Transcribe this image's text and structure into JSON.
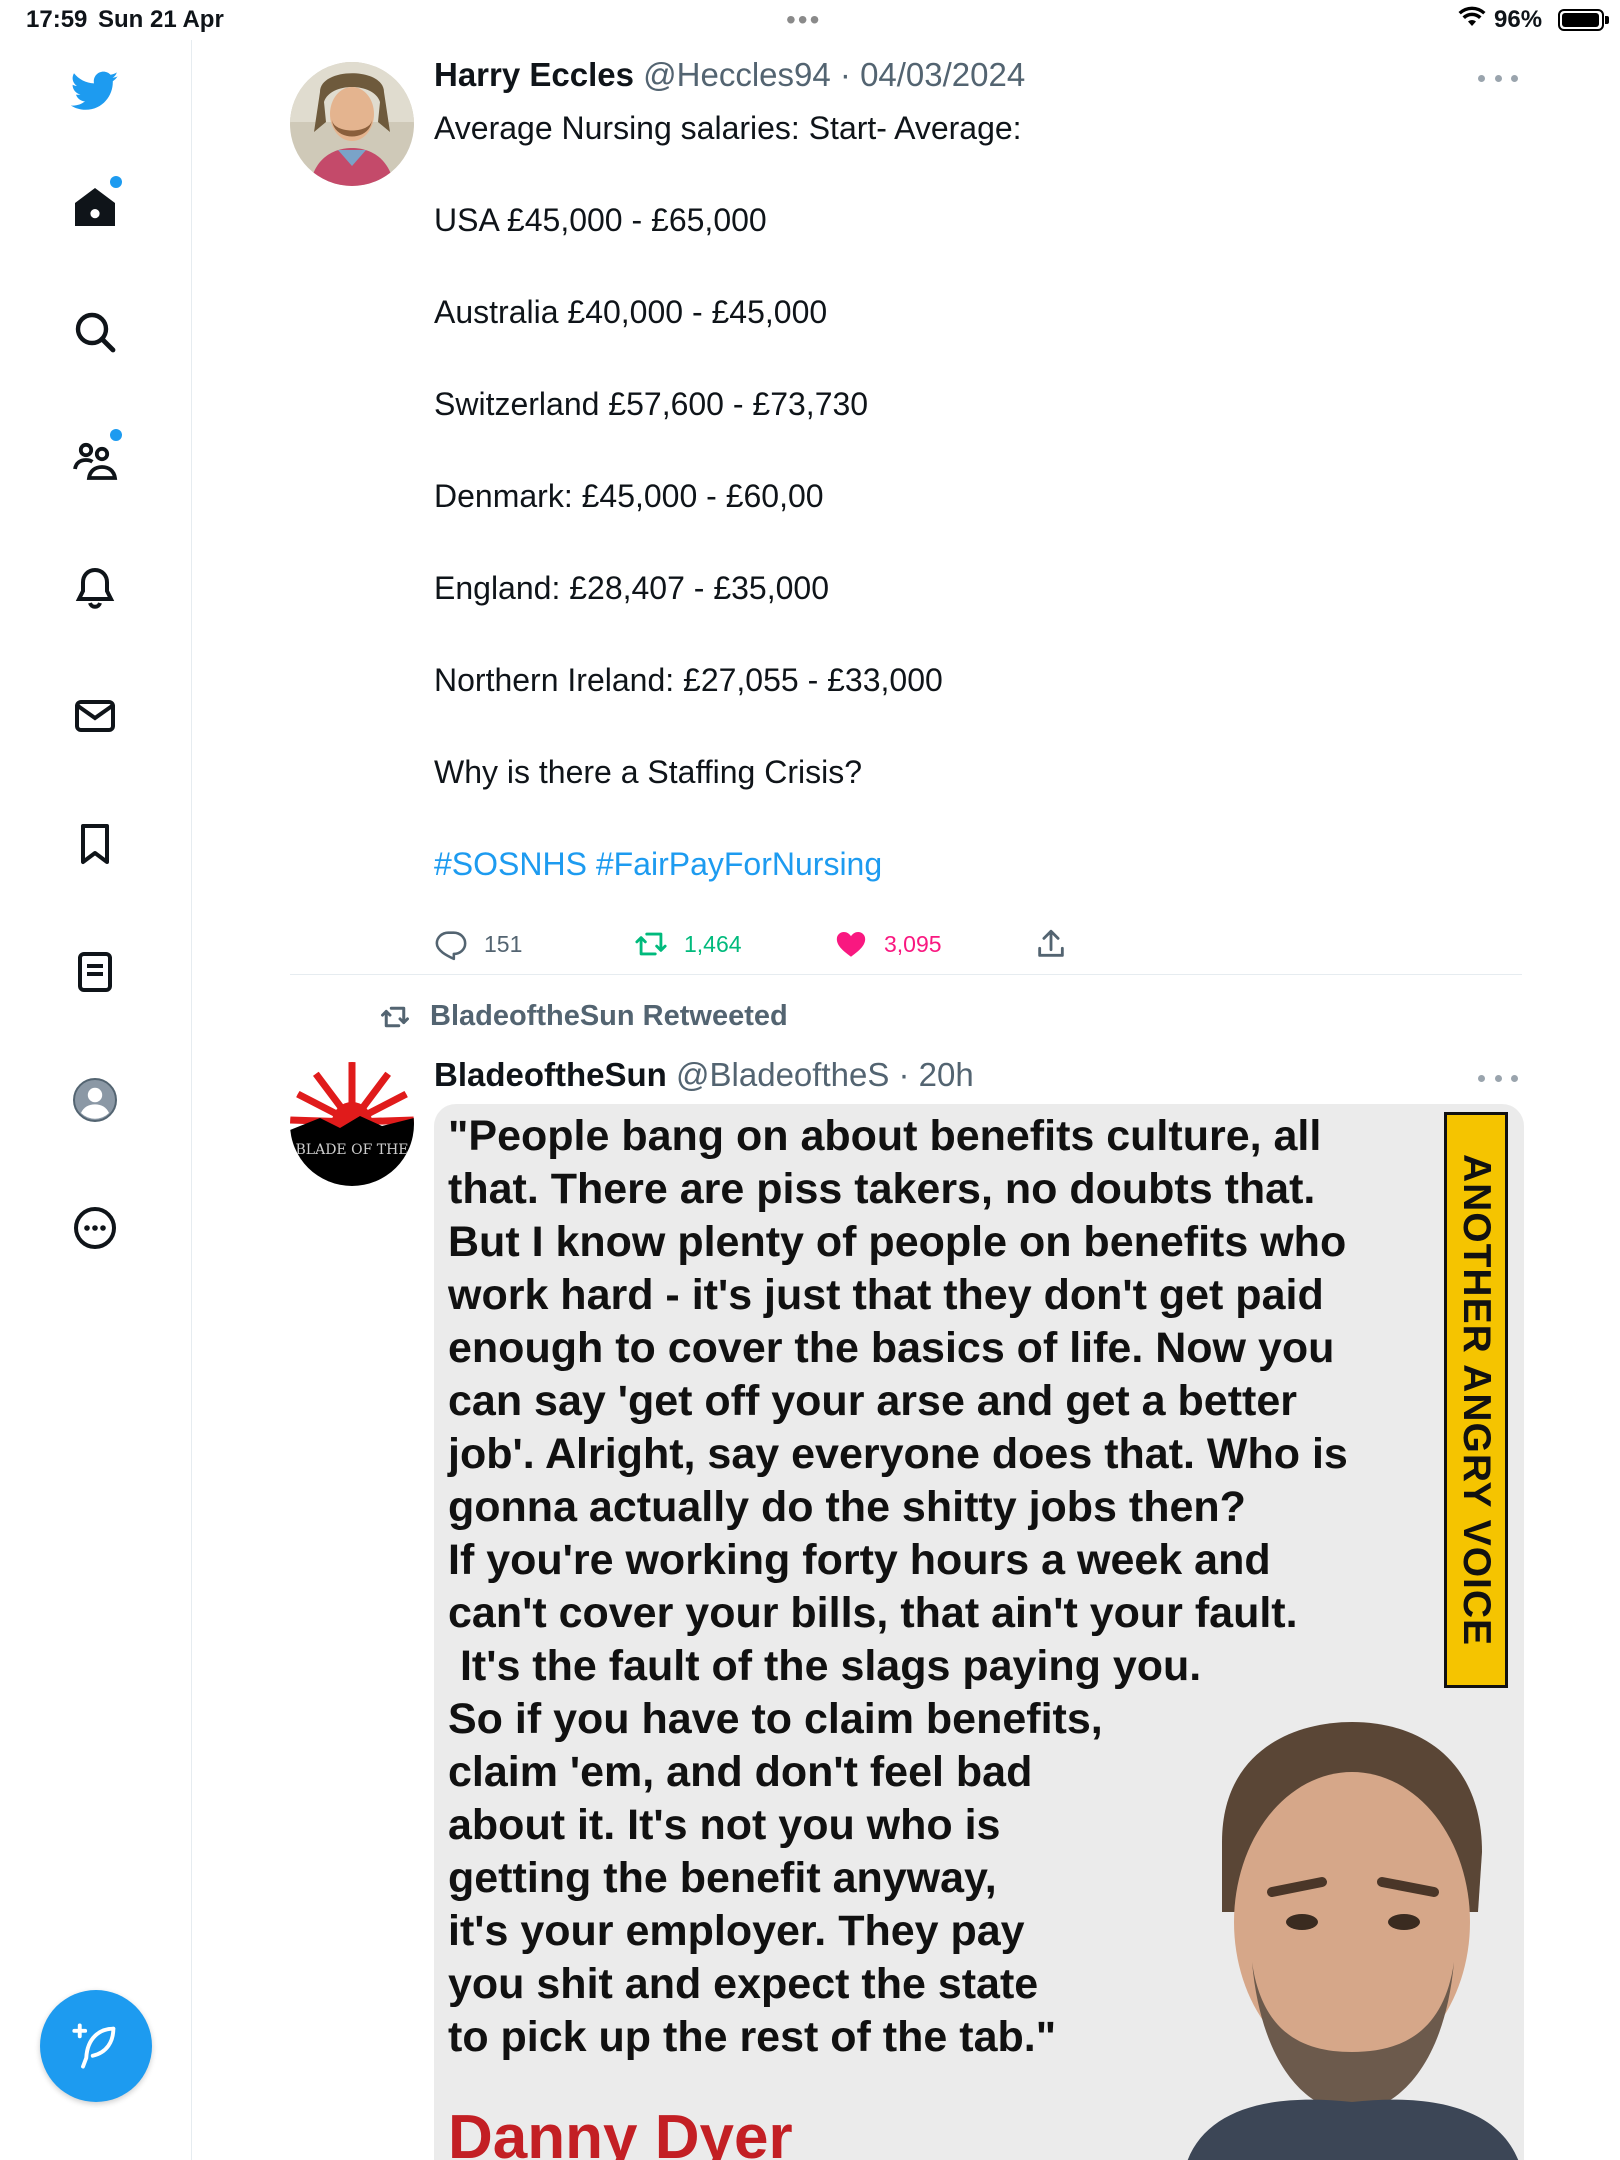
{
  "status_bar": {
    "time": "17:59",
    "date": "Sun 21 Apr",
    "battery": "96%"
  },
  "sidebar": {
    "items": [
      {
        "name": "twitter-logo-icon"
      },
      {
        "name": "home-icon"
      },
      {
        "name": "search-icon"
      },
      {
        "name": "communities-icon"
      },
      {
        "name": "notifications-icon"
      },
      {
        "name": "messages-icon"
      },
      {
        "name": "bookmarks-icon"
      },
      {
        "name": "lists-icon"
      },
      {
        "name": "profile-icon"
      },
      {
        "name": "more-icon"
      }
    ],
    "compose_icon": "compose-icon"
  },
  "tweet1": {
    "name": "Harry Eccles",
    "handle": "@Heccles94",
    "date": "04/03/2024",
    "lines": [
      "Average Nursing salaries: Start- Average:",
      "USA £45,000 - £65,000",
      "Australia £40,000 -  £45,000",
      "Switzerland £57,600 -  £73,730",
      "Denmark: £45,000 - £60,00",
      "England: £28,407 - £35,000",
      "Northern Ireland: £27,055 - £33,000",
      "Why is there a Staffing Crisis?"
    ],
    "hashtags": "#SOSNHS #FairPayForNursing",
    "replies": "151",
    "retweets": "1,464",
    "likes": "3,095",
    "colors": {
      "retweet": "#00ba7c",
      "like": "#f91880",
      "link": "#1d9bf0"
    }
  },
  "tweet2": {
    "retweeted_by": "BladeoftheSun Retweeted",
    "name": "BladeoftheSun",
    "handle": "@BladeoftheS",
    "time": "20h",
    "avatar_text": "BLADE OF THE",
    "image": {
      "quote": "\"People bang on about benefits culture, all\nthat. There are piss takers, no doubts that.\nBut I know plenty of people on benefits who\nwork hard - it's just that they don't get paid\nenough to cover the basics of life. Now you\ncan say 'get off your arse and get a better\njob'. Alright, say everyone does that. Who is\ngonna actually do the shitty jobs then?\nIf you're working forty hours a week and\ncan't cover your bills, that ain't your fault.\n It's the fault of the slags paying you.\nSo if you have to claim benefits,\nclaim 'em, and don't feel bad\nabout it. It's not you who is\ngetting the benefit anyway,\nit's your employer. They pay\nyou shit and expect the state\nto pick up the rest of the tab.\"",
      "banner": "ANOTHER ANGRY VOICE",
      "author": "Danny Dyer"
    }
  }
}
